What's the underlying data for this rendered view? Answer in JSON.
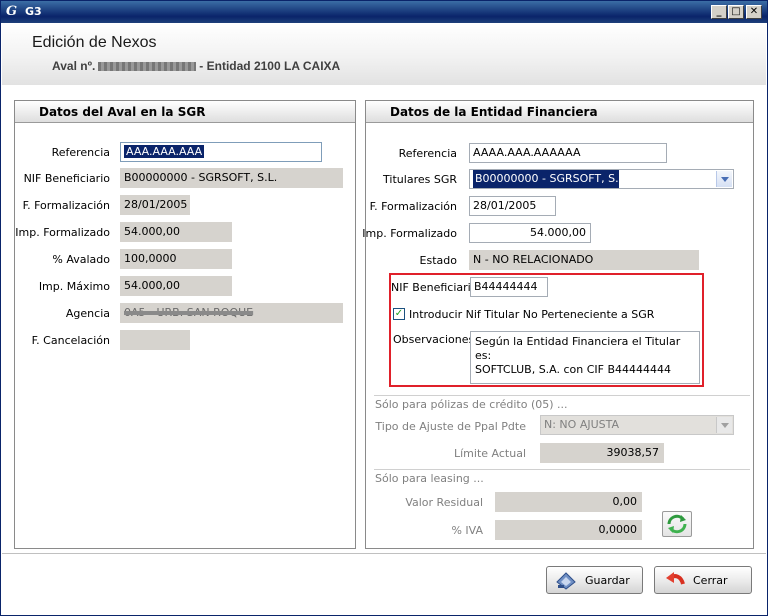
{
  "window": {
    "title": "G3",
    "logo_text": "G",
    "minimize": "_",
    "maximize": "□",
    "close": "✕"
  },
  "header": {
    "title": "Edición de Nexos",
    "subtitle_prefix": "Aval nº.",
    "subtitle_suffix": "- Entidad 2100 LA CAIXA"
  },
  "left_panel": {
    "title": "Datos del Aval en la SGR",
    "fields": [
      {
        "label": "Referencia",
        "value": "AAA.AAA.AAA"
      },
      {
        "label": "NIF Beneficiario",
        "value": "B00000000 - SGRSOFT, S.L."
      },
      {
        "label": "F. Formalización",
        "value": "28/01/2005"
      },
      {
        "label": "Imp. Formalizado",
        "value": "54.000,00"
      },
      {
        "label": "% Avalado",
        "value": "100,0000"
      },
      {
        "label": "Imp. Máximo",
        "value": "54.000,00"
      },
      {
        "label": "Agencia",
        "value": "0A5 - URB. SAN ROQUE"
      },
      {
        "label": "F. Cancelación",
        "value": ""
      }
    ]
  },
  "right_panel": {
    "title": "Datos de la Entidad Financiera",
    "referencia": {
      "label": "Referencia",
      "value": "AAAA.AAA.AAAAAA"
    },
    "titulares": {
      "label": "Titulares SGR",
      "value": "B00000000 - SGRSOFT, S.L."
    },
    "f_formalizacion": {
      "label": "F. Formalización",
      "value": "28/01/2005"
    },
    "imp_formalizado": {
      "label": "Imp. Formalizado",
      "value": "54.000,00"
    },
    "estado": {
      "label": "Estado",
      "value": "N - NO  RELACIONADO"
    },
    "nif_beneficiario": {
      "label": "NIF Beneficiario",
      "value": "B44444444"
    },
    "checkbox": {
      "label": "Introducir Nif Titular No Perteneciente a SGR",
      "checked": true,
      "mark": "✓"
    },
    "observaciones": {
      "label": "Observaciones",
      "line1": "Según la Entidad Financiera el Titular es:",
      "line2": "SOFTCLUB, S.A. con CIF B44444444"
    },
    "credito": {
      "section": "Sólo para pólizas de crédito (05) ...",
      "ajuste_label": "Tipo de Ajuste de Ppal Pdte",
      "ajuste_value": "N: NO AJUSTA",
      "limite_label": "Límite Actual",
      "limite_value": "39038,57"
    },
    "leasing": {
      "section": "Sólo para leasing ...",
      "residual_label": "Valor Residual",
      "residual_value": "0,00",
      "iva_label": "% IVA",
      "iva_value": "0,0000"
    }
  },
  "buttons": {
    "guardar": "Guardar",
    "cerrar": "Cerrar"
  },
  "colors": {
    "titlebar": "#0a246a",
    "selection": "#0a246a",
    "highlight_box": "#e0202a",
    "readonly_field": "#d6d3ce"
  }
}
